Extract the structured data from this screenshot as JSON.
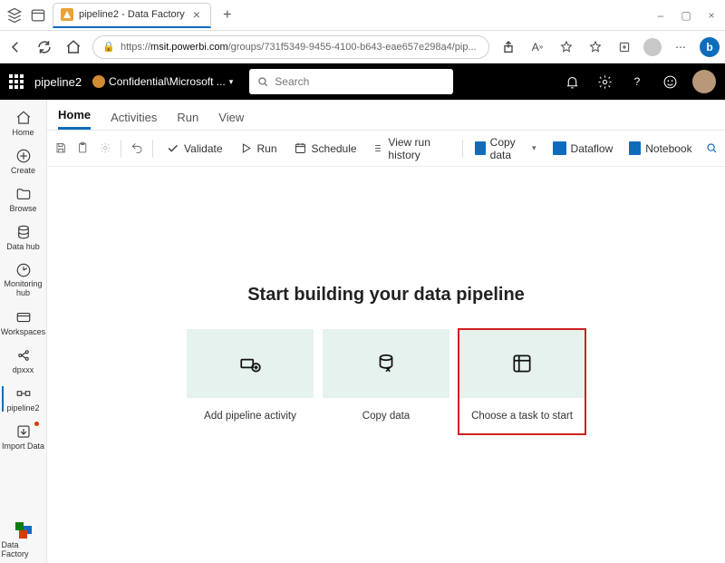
{
  "browser": {
    "tab_title": "pipeline2 - Data Factory",
    "url_host": "msit.powerbi.com",
    "url_path": "/groups/731f5349-9455-4100-b643-eae657e298a4/pip..."
  },
  "appbar": {
    "title": "pipeline2",
    "confidentiality": "Confidential\\Microsoft ...",
    "search_placeholder": "Search"
  },
  "leftrail": {
    "items": [
      {
        "label": "Home"
      },
      {
        "label": "Create"
      },
      {
        "label": "Browse"
      },
      {
        "label": "Data hub"
      },
      {
        "label": "Monitoring hub"
      },
      {
        "label": "Workspaces"
      },
      {
        "label": "dpxxx"
      },
      {
        "label": "pipeline2"
      },
      {
        "label": "Import Data"
      }
    ],
    "footer": "Data Factory"
  },
  "tabs": [
    "Home",
    "Activities",
    "Run",
    "View"
  ],
  "toolbar": {
    "validate": "Validate",
    "run": "Run",
    "schedule": "Schedule",
    "history": "View run history",
    "copydata": "Copy data",
    "dataflow": "Dataflow",
    "notebook": "Notebook"
  },
  "canvas": {
    "heading": "Start building your data pipeline",
    "cards": [
      {
        "label": "Add pipeline activity"
      },
      {
        "label": "Copy data"
      },
      {
        "label": "Choose a task to start"
      }
    ]
  }
}
